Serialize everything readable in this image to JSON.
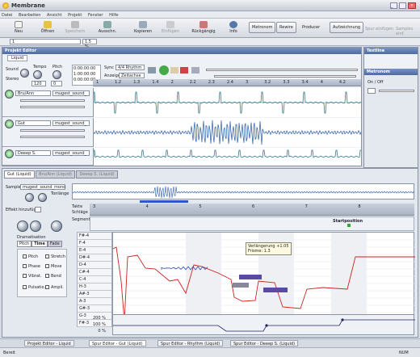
{
  "app": {
    "title": "Membrane"
  },
  "menu": [
    "Datei",
    "Bearbeiten",
    "Ansicht",
    "Projekt",
    "Fenster",
    "Hilfe"
  ],
  "toolbar": {
    "buttons": [
      "Neu",
      "Öffnen",
      "Speichern",
      "Ausschn.",
      "Kopieren",
      "Einfügen",
      "Rückgängig",
      "Info"
    ],
    "modes": [
      "Metronom",
      "Rewire",
      "Producer",
      "Aufzeichnung"
    ],
    "right": [
      "Spur einfügen",
      "Samples einf."
    ]
  },
  "address": {
    "value": "1",
    "zoom": "1.5 %"
  },
  "project": {
    "title": "Projekt Editor",
    "tab": "Liquid",
    "sound": "Sound",
    "stereo": "Stereo",
    "tempo": "Tempo",
    "pitch": "Pitch",
    "tempo_val": "120",
    "pitch_val": "0",
    "sync_label": "Sync",
    "sync_val": "4/4 Rhythm",
    "anzeige_label": "Anzeige",
    "anzeige_val": "Zeitachse",
    "times": [
      "0:00:00:00",
      "1:00:00:00",
      "0:00:00:00"
    ],
    "ruler": [
      "1",
      "1.2",
      "1.3",
      "1.4",
      "2",
      "2.2",
      "2.3",
      "2.4",
      "3",
      "3.2",
      "3.3",
      "3.4",
      "4",
      "4.2"
    ],
    "tracks": [
      {
        "name": "Bru/Ann",
        "sample": "mugest_sound_"
      },
      {
        "name": "Gut",
        "sample": "mugest_sound_"
      },
      {
        "name": "Deeep S.",
        "sample": "mugest_sound_"
      }
    ]
  },
  "rightpanel": {
    "title1": "Textline",
    "title2": "Metronom",
    "onoff": "On / Off"
  },
  "track_editor": {
    "tabs": [
      "Gut (Liquid)",
      "Bru/Ann (Liquid)",
      "Deeep S. (Liquid)"
    ],
    "sample_label": "Sample",
    "sample_val": "mugest_sound_mono",
    "tonlange": "Tonlänge",
    "effekt": "Effekt hinzufüg.",
    "takte": "Takte",
    "schlaege": "Schläge",
    "segment": "Segment(e)",
    "dramatisation": "Dramatisation",
    "tabs2": [
      "Pitch",
      "Time",
      "Fade"
    ],
    "checks": [
      "Pitch",
      "Stretch",
      "Phase",
      "Move",
      "Vibrat.",
      "Bend",
      "Pulsatio.",
      "Ampli."
    ],
    "keys": [
      "F#-4",
      "F-4",
      "E-4",
      "D#-4",
      "D-4",
      "C#-4",
      "C-4",
      "H-3",
      "A#-3",
      "A-3",
      "G#-3",
      "G-3",
      "F#-3"
    ],
    "tooltip1": "Verlängerung +1.05",
    "tooltip2": "Frisme: 1.3",
    "marker": "Startposition",
    "bottom_scale": [
      "200 %",
      "100 %",
      "0 %"
    ],
    "ruler": [
      "3",
      "4",
      "5",
      "6",
      "7",
      "8"
    ]
  },
  "tabs_bottom": [
    "Projekt Editor - Liquid",
    "Spur Editor - Gut (Liquid)",
    "Spur Editor - Rhythm (Liquid)",
    "Spur Editor - Deeep S. (Liquid)"
  ],
  "status": {
    "left": "Bereit",
    "right": "NUM"
  }
}
